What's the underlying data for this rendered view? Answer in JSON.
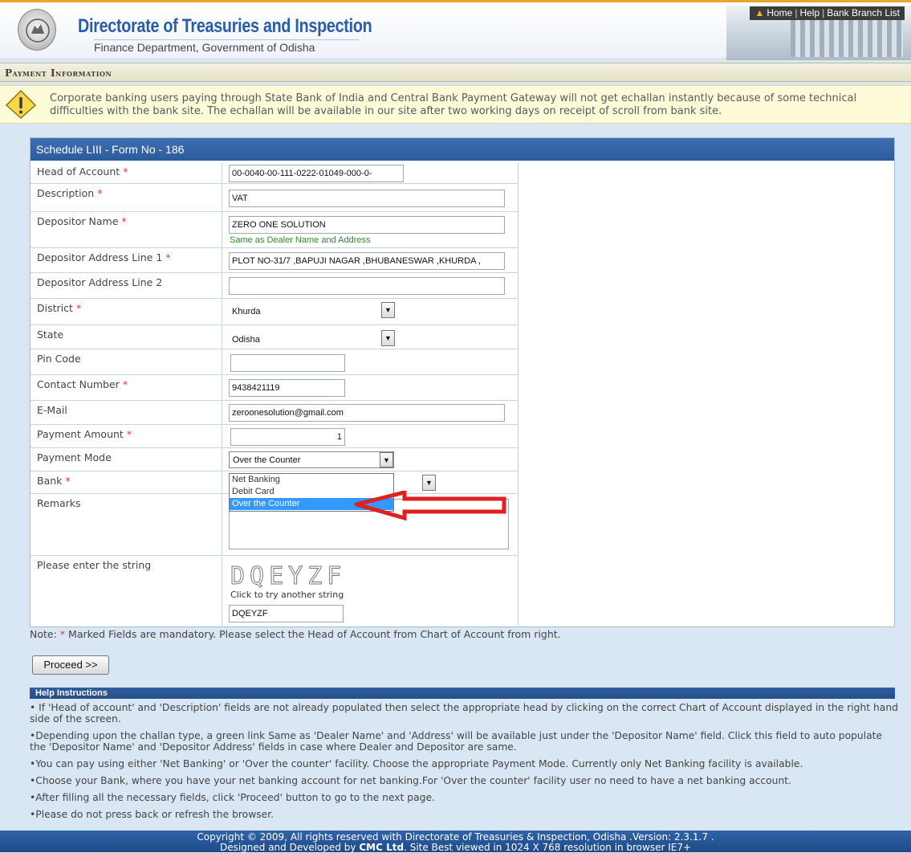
{
  "header": {
    "title": "Directorate of Treasuries and Inspection",
    "subtitle": "Finance Department, Government of Odisha",
    "links": [
      "Home",
      "Help",
      "Bank Branch List"
    ]
  },
  "section_title": "Payment Information",
  "warning": "Corporate banking users paying through State Bank of India and Central Bank Payment Gateway will not get echallan instantly because of some technical difficulties with the bank site. The echallan will be available in our site after two working days on receipt of scroll from bank site.",
  "form": {
    "title": "Schedule LIII - Form No - 186",
    "required_mark": "*",
    "labels": {
      "head_of_account": "Head of Account",
      "description": "Description",
      "depositor_name": "Depositor Name",
      "address1": "Depositor Address Line 1",
      "address2": "Depositor Address Line 2",
      "district": "District",
      "state": "State",
      "pin": "Pin Code",
      "contact": "Contact Number",
      "email": "E-Mail",
      "amount": "Payment Amount",
      "mode": "Payment Mode",
      "bank": "Bank",
      "remarks": "Remarks",
      "captcha": "Please enter the string"
    },
    "values": {
      "head_of_account": "00-0040-00-111-0222-01049-000-0-",
      "description": "VAT",
      "depositor_name": "ZERO ONE SOLUTION",
      "same_as_dealer": "Same as Dealer Name and Address",
      "address1": "PLOT NO-31/7 ,BAPUJI NAGAR ,BHUBANESWAR ,KHURDA ,",
      "address2": "",
      "district": "Khurda",
      "state": "Odisha",
      "pin": "",
      "contact": "9438421119",
      "email": "zeroonesolution@gmail.com",
      "amount": "1",
      "mode": "Over the Counter",
      "captcha_image_text": "DQEYZF",
      "captcha_hint": "Click to try another string",
      "captcha_input": "DQEYZF"
    },
    "mode_options": [
      "Net Banking",
      "Debit Card",
      "Over the Counter"
    ]
  },
  "note_prefix": "Note:",
  "note_text": "Marked Fields are mandatory. Please select the Head of Account from Chart of Account from right.",
  "proceed_label": "Proceed >>",
  "help_title": "Help Instructions",
  "help_items": [
    "• If 'Head of account' and 'Description' fields are not already populated then select the appropriate head by clicking on the correct Chart of Account displayed in the right hand side of the screen.",
    "•Depending upon the challan type, a green link Same as 'Dealer Name' and 'Address' will be available just under the 'Depositor Name' field. Click this field to auto populate the 'Depositor Name' and 'Depositor Address' fields in case where Dealer and Depositor are same.",
    "•You can pay using either 'Net Banking' or 'Over the counter' facility. Choose the appropriate Payment Mode. Currently only Net Banking facility is available.",
    "•Choose your Bank, where you have your net banking account for net banking.For 'Over the counter' facility user no need to have a net banking account.",
    "•After filling all the necessary fields, click 'Proceed' button to go to the next page.",
    "•Please do not press back or refresh the browser."
  ],
  "footer": {
    "line1": "Copyright © 2009, All rights reserved with Directorate of Treasuries & Inspection, Odisha .Version: 2.3.1.7 .",
    "line2_prefix": "Designed and Developed by",
    "line2_company": "CMC Ltd",
    "line2_suffix": ". Site Best viewed in 1024 X 768 resolution in browser IE7+"
  },
  "colors": {
    "accent_blue": "#2c5b9c",
    "warning_bg": "#fdfbd8",
    "required": "#e03a3a",
    "link_green": "#2f8a2f",
    "arrow_red": "#e02020"
  },
  "icons": [
    "emblem-icon",
    "home-icon",
    "warning-icon",
    "dropdown-arrow-icon",
    "red-arrow-icon"
  ]
}
